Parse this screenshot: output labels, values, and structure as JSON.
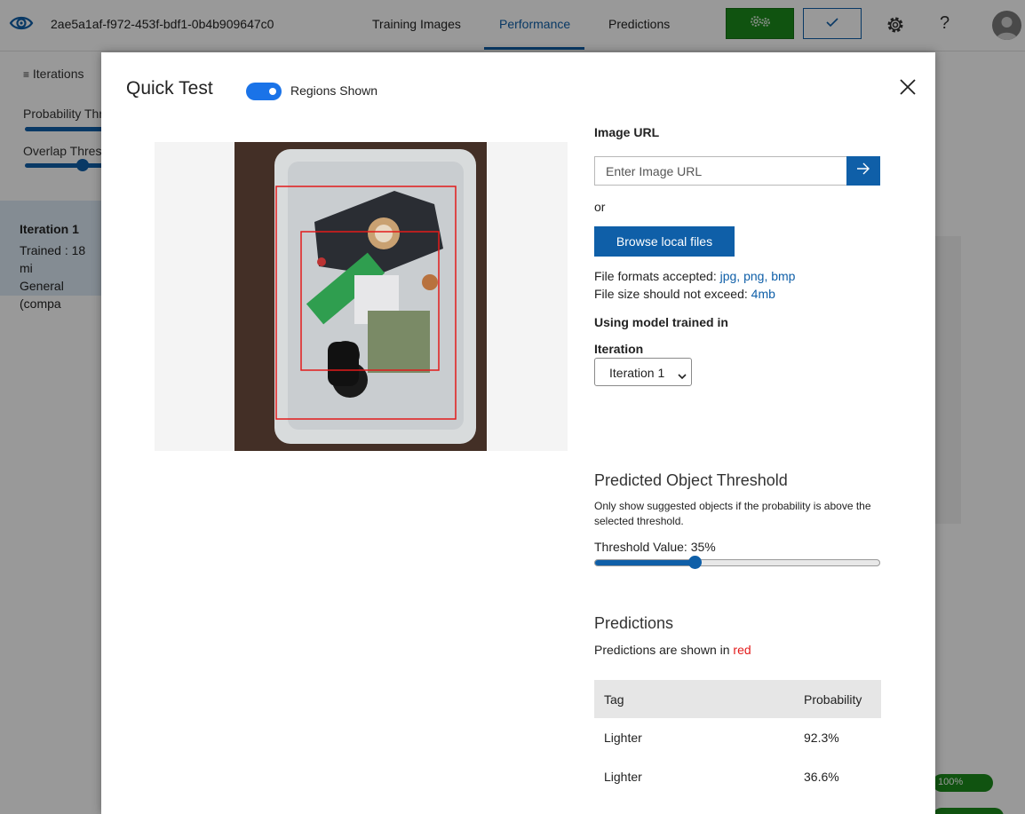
{
  "header": {
    "project_id": "2ae5a1af-f972-453f-bdf1-0b4b909647c0",
    "tabs": [
      {
        "label": "Training Images",
        "active": false
      },
      {
        "label": "Performance",
        "active": true
      },
      {
        "label": "Predictions",
        "active": false
      }
    ],
    "train_button_icon": "gears-icon",
    "quick_test_button_icon": "check-icon",
    "settings_icon": "gear-icon",
    "help_label": "?"
  },
  "background": {
    "iterations_label": "Iterations",
    "probability_label": "Probability Thr",
    "overlap_label": "Overlap Thresh",
    "iteration_card": {
      "title": "Iteration 1",
      "trained": "Trained : 18 mi",
      "domain": "General (compa"
    },
    "progress_label": "100%"
  },
  "modal": {
    "title": "Quick Test",
    "regions_toggle_label": "Regions Shown",
    "regions_shown": true,
    "image_url_label": "Image URL",
    "image_url_placeholder": "Enter Image URL",
    "image_url_value": "",
    "or_label": "or",
    "browse_button": "Browse local files",
    "formats_label": "File formats accepted: ",
    "formats_value": "jpg, png, bmp",
    "size_label": "File size should not exceed: ",
    "size_value": "4mb",
    "model_heading": "Using model trained in",
    "iteration_label": "Iteration",
    "iteration_selected": "Iteration 1",
    "threshold_heading": "Predicted Object Threshold",
    "threshold_desc": "Only show suggested objects if the probability is above the selected threshold.",
    "threshold_value_label": "Threshold Value: 35%",
    "threshold_value": 0.35,
    "predictions_heading": "Predictions",
    "predictions_note_prefix": "Predictions are shown in ",
    "predictions_note_color": "red",
    "table": {
      "headers": [
        "Tag",
        "Probability"
      ],
      "rows": [
        {
          "tag": "Lighter",
          "probability": "92.3%"
        },
        {
          "tag": "Lighter",
          "probability": "36.6%"
        }
      ]
    }
  },
  "colors": {
    "accent": "#0f5fa8",
    "train_green": "#1c8a1c",
    "prediction_red": "#e31b1b"
  }
}
